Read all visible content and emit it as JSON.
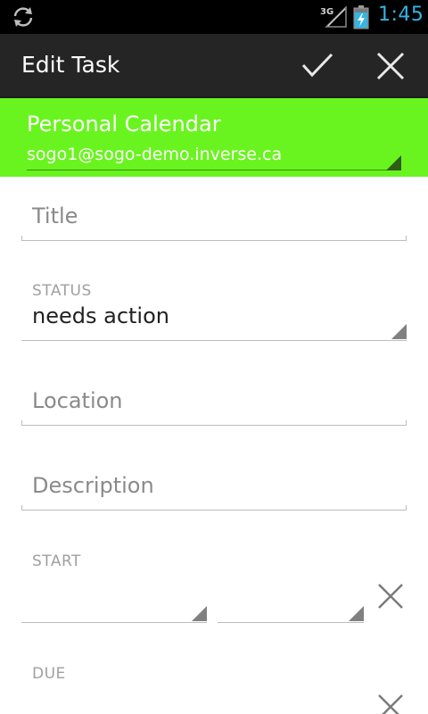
{
  "status_bar": {
    "network_type": "3G",
    "time": "1:45",
    "clock_color": "#33b5e5",
    "icons": [
      "sync-icon",
      "signal-icon",
      "battery-charging-icon"
    ]
  },
  "action_bar": {
    "title": "Edit Task",
    "done_icon": "checkmark-icon",
    "cancel_icon": "close-icon"
  },
  "calendar": {
    "name": "Personal Calendar",
    "account": "sogo1@sogo-demo.inverse.ca",
    "color": "#6af41f"
  },
  "form": {
    "title_placeholder": "Title",
    "status_label": "STATUS",
    "status_value": "needs action",
    "location_placeholder": "Location",
    "description_placeholder": "Description",
    "start_label": "START",
    "start_date": "",
    "start_time": "",
    "due_label": "DUE"
  }
}
